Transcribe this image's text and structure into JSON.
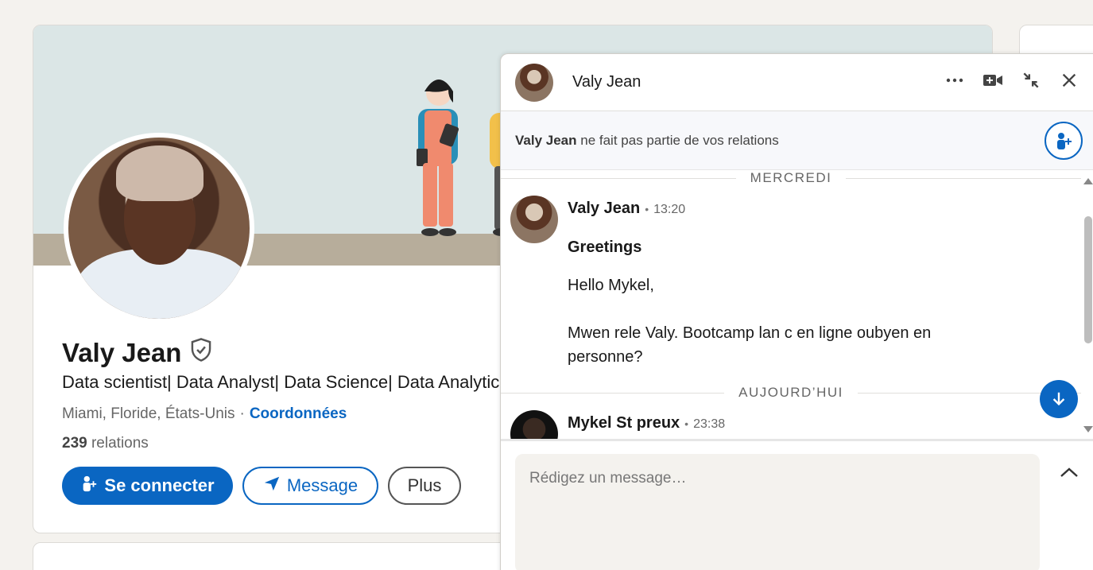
{
  "profile": {
    "name": "Valy Jean",
    "headline": "Data scientist| Data Analyst| Data Science| Data Analytics",
    "location": "Miami, Floride, États-Unis",
    "separator": "·",
    "contact_link": "Coordonnées",
    "relations_count": "239",
    "relations_label": "relations",
    "actions": {
      "connect": "Se connecter",
      "message": "Message",
      "more": "Plus"
    }
  },
  "messaging": {
    "header_name": "Valy Jean",
    "notice_name": "Valy Jean",
    "notice_text": "ne fait pas partie de vos relations",
    "composer_placeholder": "Rédigez un message…",
    "thread": [
      {
        "date_label": "MERCREDI",
        "sender": "Valy Jean",
        "dot": "•",
        "time": "13:20",
        "subject": "Greetings",
        "paragraphs": [
          "Hello Mykel,",
          "Mwen rele Valy. Bootcamp lan c en ligne oubyen en personne?"
        ]
      },
      {
        "date_label": "AUJOURD’HUI",
        "sender": "Mykel St preux",
        "dot": "•",
        "time": "23:38"
      }
    ]
  },
  "colors": {
    "brand_blue": "#0a66c2",
    "page_bg": "#f4f2ee"
  }
}
